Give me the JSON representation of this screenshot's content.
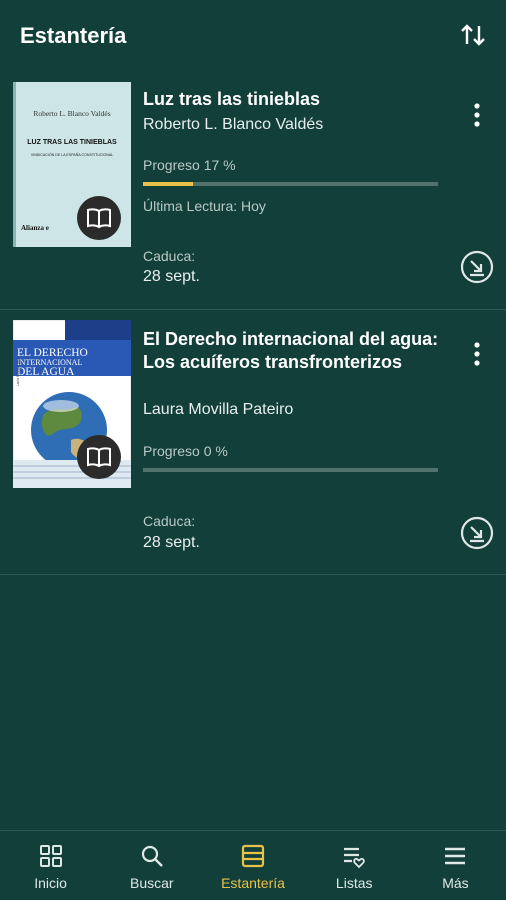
{
  "header": {
    "title": "Estantería",
    "sort_icon": "sort-arrows-icon"
  },
  "books": [
    {
      "title": "Luz tras las tinieblas",
      "author": "Roberto L. Blanco Valdés",
      "progress_text": "Progreso 17 %",
      "progress": 17,
      "last_read": "Última Lectura: Hoy",
      "due_label": "Caduca:",
      "due_date": "28 sept.",
      "cover": {
        "author": "Roberto L. Blanco Valdés",
        "title": "LUZ TRAS LAS TINIEBLAS",
        "subtitle": "VINDICACIÓN DE LA ESPAÑA CONSTITUCIONAL",
        "publisher": "Alianza e"
      }
    },
    {
      "title": "El Derecho internacional del agua: Los acuíferos transfronterizos",
      "author": "Laura Movilla Pateiro",
      "progress_text": "Progreso 0 %",
      "progress": 0,
      "due_label": "Caduca:",
      "due_date": "28 sept.",
      "cover": {
        "author": "Laura Movilla Pateiro",
        "title_line1": "EL DERECHO",
        "title_line2": "INTERNACIONAL",
        "title_line3": "DEL AGUA"
      }
    }
  ],
  "nav": [
    {
      "label": "Inicio",
      "icon": "grid-icon"
    },
    {
      "label": "Buscar",
      "icon": "search-icon"
    },
    {
      "label": "Estantería",
      "icon": "bookshelf-icon",
      "active": true
    },
    {
      "label": "Listas",
      "icon": "list-heart-icon"
    },
    {
      "label": "Más",
      "icon": "menu-icon"
    }
  ],
  "colors": {
    "accent": "#e8c14a",
    "background": "#123f3a"
  }
}
